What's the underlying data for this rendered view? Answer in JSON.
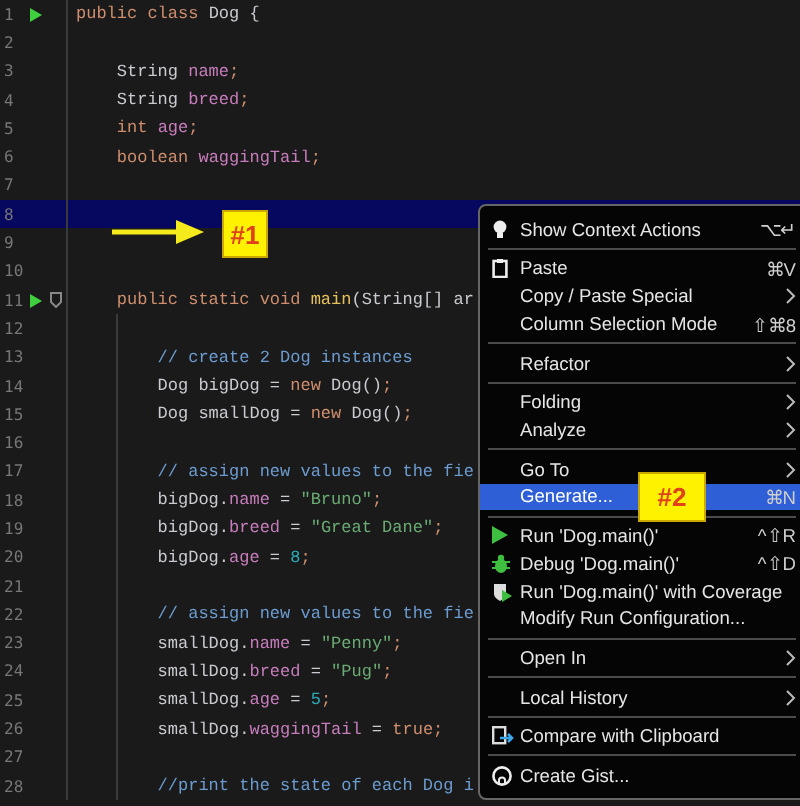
{
  "editor": {
    "lines": [
      {
        "number": "1",
        "run": true,
        "fold": false,
        "guide": false,
        "highlighted": false,
        "tokens": [
          {
            "text": "public class ",
            "kind": "keyword"
          },
          {
            "text": "Dog {",
            "kind": "plain"
          }
        ]
      },
      {
        "number": "2",
        "run": false,
        "fold": false,
        "guide": false,
        "highlighted": false
      },
      {
        "number": "3",
        "run": false,
        "fold": false,
        "guide": false,
        "highlighted": false,
        "tokens": [
          {
            "text": "    String ",
            "kind": "plain"
          },
          {
            "text": "name",
            "kind": "field"
          },
          {
            "text": ";",
            "kind": "keyword"
          }
        ]
      },
      {
        "number": "4",
        "run": false,
        "fold": false,
        "guide": false,
        "highlighted": false,
        "tokens": [
          {
            "text": "    String ",
            "kind": "plain"
          },
          {
            "text": "breed",
            "kind": "field"
          },
          {
            "text": ";",
            "kind": "keyword"
          }
        ]
      },
      {
        "number": "5",
        "run": false,
        "fold": false,
        "guide": false,
        "highlighted": false,
        "tokens": [
          {
            "text": "    int ",
            "kind": "keyword"
          },
          {
            "text": "age",
            "kind": "field"
          },
          {
            "text": ";",
            "kind": "keyword"
          }
        ]
      },
      {
        "number": "6",
        "run": false,
        "fold": false,
        "guide": false,
        "highlighted": false,
        "tokens": [
          {
            "text": "    boolean ",
            "kind": "keyword"
          },
          {
            "text": "waggingTail",
            "kind": "field"
          },
          {
            "text": ";",
            "kind": "keyword"
          }
        ]
      },
      {
        "number": "7",
        "run": false,
        "fold": false,
        "guide": false,
        "highlighted": false
      },
      {
        "number": "8",
        "run": false,
        "fold": false,
        "guide": false,
        "highlighted": true
      },
      {
        "number": "9",
        "run": false,
        "fold": false,
        "guide": false,
        "highlighted": false
      },
      {
        "number": "10",
        "run": false,
        "fold": false,
        "guide": false,
        "highlighted": false
      },
      {
        "number": "11",
        "run": true,
        "fold": true,
        "guide": false,
        "highlighted": false,
        "tokens": [
          {
            "text": "    public static void ",
            "kind": "keyword"
          },
          {
            "text": "main",
            "kind": "method"
          },
          {
            "text": "(String[] ar",
            "kind": "plain"
          }
        ]
      },
      {
        "number": "12",
        "run": false,
        "fold": false,
        "guide": true,
        "highlighted": false
      },
      {
        "number": "13",
        "run": false,
        "fold": false,
        "guide": true,
        "highlighted": false,
        "tokens": [
          {
            "text": "        // create 2 Dog instances",
            "kind": "comment"
          }
        ]
      },
      {
        "number": "14",
        "run": false,
        "fold": false,
        "guide": true,
        "highlighted": false,
        "tokens": [
          {
            "text": "        Dog bigDog = ",
            "kind": "plain"
          },
          {
            "text": "new ",
            "kind": "keyword"
          },
          {
            "text": "Dog()",
            "kind": "plain"
          },
          {
            "text": ";",
            "kind": "keyword"
          }
        ]
      },
      {
        "number": "15",
        "run": false,
        "fold": false,
        "guide": true,
        "highlighted": false,
        "tokens": [
          {
            "text": "        Dog smallDog = ",
            "kind": "plain"
          },
          {
            "text": "new ",
            "kind": "keyword"
          },
          {
            "text": "Dog()",
            "kind": "plain"
          },
          {
            "text": ";",
            "kind": "keyword"
          }
        ]
      },
      {
        "number": "16",
        "run": false,
        "fold": false,
        "guide": true,
        "highlighted": false
      },
      {
        "number": "17",
        "run": false,
        "fold": false,
        "guide": true,
        "highlighted": false,
        "tokens": [
          {
            "text": "        // assign new values to the fie",
            "kind": "comment"
          }
        ]
      },
      {
        "number": "18",
        "run": false,
        "fold": false,
        "guide": true,
        "highlighted": false,
        "tokens": [
          {
            "text": "        bigDog.",
            "kind": "plain"
          },
          {
            "text": "name",
            "kind": "field"
          },
          {
            "text": " = ",
            "kind": "plain"
          },
          {
            "text": "\"Bruno\"",
            "kind": "string"
          },
          {
            "text": ";",
            "kind": "keyword"
          }
        ]
      },
      {
        "number": "19",
        "run": false,
        "fold": false,
        "guide": true,
        "highlighted": false,
        "tokens": [
          {
            "text": "        bigDog.",
            "kind": "plain"
          },
          {
            "text": "breed",
            "kind": "field"
          },
          {
            "text": " = ",
            "kind": "plain"
          },
          {
            "text": "\"Great Dane\"",
            "kind": "string"
          },
          {
            "text": ";",
            "kind": "keyword"
          }
        ]
      },
      {
        "number": "20",
        "run": false,
        "fold": false,
        "guide": true,
        "highlighted": false,
        "tokens": [
          {
            "text": "        bigDog.",
            "kind": "plain"
          },
          {
            "text": "age",
            "kind": "field"
          },
          {
            "text": " = ",
            "kind": "plain"
          },
          {
            "text": "8",
            "kind": "number"
          },
          {
            "text": ";",
            "kind": "keyword"
          }
        ]
      },
      {
        "number": "21",
        "run": false,
        "fold": false,
        "guide": true,
        "highlighted": false
      },
      {
        "number": "22",
        "run": false,
        "fold": false,
        "guide": true,
        "highlighted": false,
        "tokens": [
          {
            "text": "        // assign new values to the fie",
            "kind": "comment"
          }
        ]
      },
      {
        "number": "23",
        "run": false,
        "fold": false,
        "guide": true,
        "highlighted": false,
        "tokens": [
          {
            "text": "        smallDog.",
            "kind": "plain"
          },
          {
            "text": "name",
            "kind": "field"
          },
          {
            "text": " = ",
            "kind": "plain"
          },
          {
            "text": "\"Penny\"",
            "kind": "string"
          },
          {
            "text": ";",
            "kind": "keyword"
          }
        ]
      },
      {
        "number": "24",
        "run": false,
        "fold": false,
        "guide": true,
        "highlighted": false,
        "tokens": [
          {
            "text": "        smallDog.",
            "kind": "plain"
          },
          {
            "text": "breed",
            "kind": "field"
          },
          {
            "text": " = ",
            "kind": "plain"
          },
          {
            "text": "\"Pug\"",
            "kind": "string"
          },
          {
            "text": ";",
            "kind": "keyword"
          }
        ]
      },
      {
        "number": "25",
        "run": false,
        "fold": false,
        "guide": true,
        "highlighted": false,
        "tokens": [
          {
            "text": "        smallDog.",
            "kind": "plain"
          },
          {
            "text": "age",
            "kind": "field"
          },
          {
            "text": " = ",
            "kind": "plain"
          },
          {
            "text": "5",
            "kind": "number"
          },
          {
            "text": ";",
            "kind": "keyword"
          }
        ]
      },
      {
        "number": "26",
        "run": false,
        "fold": false,
        "guide": true,
        "highlighted": false,
        "tokens": [
          {
            "text": "        smallDog.",
            "kind": "plain"
          },
          {
            "text": "waggingTail",
            "kind": "field"
          },
          {
            "text": " = ",
            "kind": "plain"
          },
          {
            "text": "true",
            "kind": "keyword"
          },
          {
            "text": ";",
            "kind": "keyword"
          }
        ]
      },
      {
        "number": "27",
        "run": false,
        "fold": false,
        "guide": true,
        "highlighted": false
      },
      {
        "number": "28",
        "run": false,
        "fold": false,
        "guide": true,
        "highlighted": false,
        "tokens": [
          {
            "text": "        //print the state of each Dog i",
            "kind": "comment"
          }
        ]
      }
    ]
  },
  "annotations": [
    {
      "label": "#1"
    },
    {
      "label": "#2"
    }
  ],
  "context_menu": {
    "groups": [
      [
        {
          "label": "Show Context Actions",
          "kind": "bulb",
          "shortcut": "⌥↵",
          "submenu": false,
          "selected": false
        }
      ],
      [
        {
          "label": "Paste",
          "kind": "paste",
          "shortcut": "⌘V",
          "submenu": false,
          "selected": false
        },
        {
          "label": "Copy / Paste Special",
          "kind": "plain",
          "submenu": true,
          "selected": false
        },
        {
          "label": "Column Selection Mode",
          "kind": "plain",
          "shortcut": "⇧⌘8",
          "submenu": false,
          "selected": false
        }
      ],
      [
        {
          "label": "Refactor",
          "kind": "plain",
          "submenu": true,
          "selected": false
        }
      ],
      [
        {
          "label": "Folding",
          "kind": "plain",
          "submenu": true,
          "selected": false
        },
        {
          "label": "Analyze",
          "kind": "plain",
          "submenu": true,
          "selected": false
        }
      ],
      [
        {
          "label": "Go To",
          "kind": "plain",
          "submenu": true,
          "selected": false
        },
        {
          "label": "Generate...",
          "kind": "plain",
          "shortcut": "⌘N",
          "submenu": false,
          "selected": true
        }
      ],
      [
        {
          "label": "Run 'Dog.main()'",
          "kind": "run",
          "shortcut": "^⇧R",
          "submenu": false,
          "selected": false
        },
        {
          "label": "Debug 'Dog.main()'",
          "kind": "debug",
          "shortcut": "^⇧D",
          "submenu": false,
          "selected": false
        },
        {
          "label": "Run 'Dog.main()' with Coverage",
          "kind": "coverage",
          "submenu": false,
          "selected": false
        },
        {
          "label": "Modify Run Configuration...",
          "kind": "plain",
          "submenu": false,
          "selected": false
        }
      ],
      [
        {
          "label": "Open In",
          "kind": "plain",
          "submenu": true,
          "selected": false
        }
      ],
      [
        {
          "label": "Local History",
          "kind": "plain",
          "submenu": true,
          "selected": false
        }
      ],
      [
        {
          "label": "Compare with Clipboard",
          "kind": "compare",
          "submenu": false,
          "selected": false
        }
      ],
      [
        {
          "label": "Create Gist...",
          "kind": "gist",
          "submenu": false,
          "selected": false
        }
      ]
    ]
  }
}
